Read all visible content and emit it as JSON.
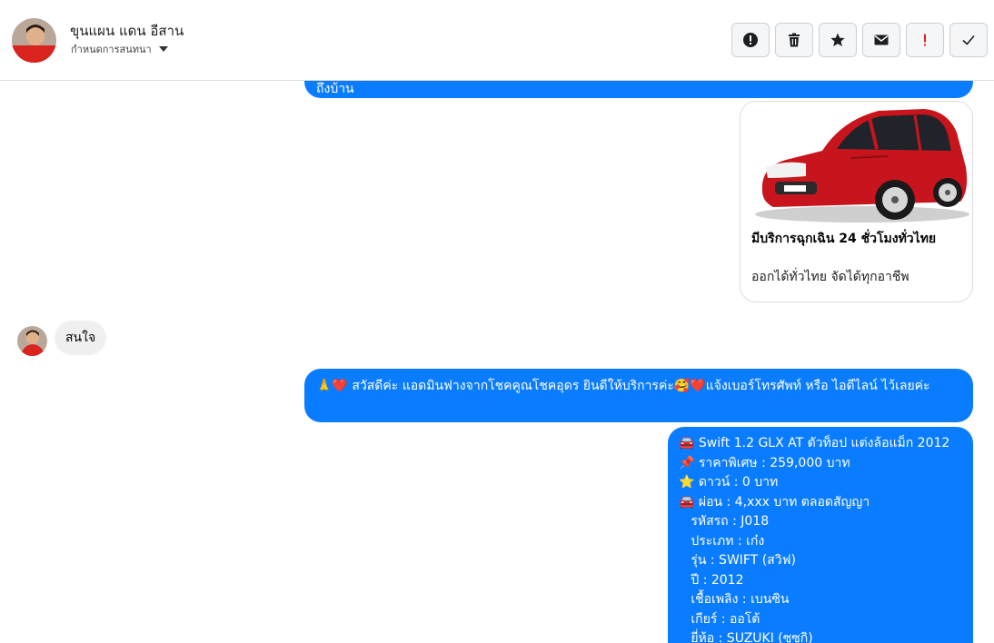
{
  "header": {
    "name": "ขุนแผน แดน อีสาน",
    "sub": "กำหนดการสนทนา",
    "actions": [
      {
        "name": "alert-icon-button",
        "icon": "exclamation-circle-icon"
      },
      {
        "name": "delete-button",
        "icon": "trash-icon"
      },
      {
        "name": "star-button",
        "icon": "star-icon"
      },
      {
        "name": "mail-button",
        "icon": "envelope-icon"
      },
      {
        "name": "important-button",
        "icon": "exclamation-icon"
      },
      {
        "name": "done-button",
        "icon": "check-icon"
      }
    ]
  },
  "messages": {
    "top_partial": "ถึงบ้าน",
    "card": {
      "title": "มีบริการฉุกเฉิน 24 ชั่วโมงทั่วไทย",
      "subtitle": "ออกได้ทั่วไทย จัดได้ทุกอาชีพ"
    },
    "incoming": "สนใจ",
    "greeting": "🙏❤️ สวัสดีค่ะ แอดมินฟางจากโชคคูณโชคอุดร ยินดีให้บริการค่ะ🥰❤️แจ้งเบอร์โทรศัพท์ หรือ ไอดีไลน์  ไว้เลยค่ะ",
    "spec": [
      "🚘 Swift 1.2 GLX AT ตัวท็อป แต่งล้อแม็ก 2012",
      "📌 ราคาพิเศษ : 259,000 บาท",
      "⭐ ดาวน์ : 0 บาท",
      "🚘 ผ่อน : 4,xxx บาท ตลอดสัญญา",
      "   รหัสรถ : J018",
      "   ประเภท : เก๋ง",
      "   รุ่น : SWIFT (สวิฟ)",
      "   ปี : 2012",
      "   เชื้อเพลิง : เบนซิน",
      "   เกียร์ : ออโต้",
      "   ยี่ห้อ : SUZUKI (ซูซูกิ)"
    ]
  }
}
